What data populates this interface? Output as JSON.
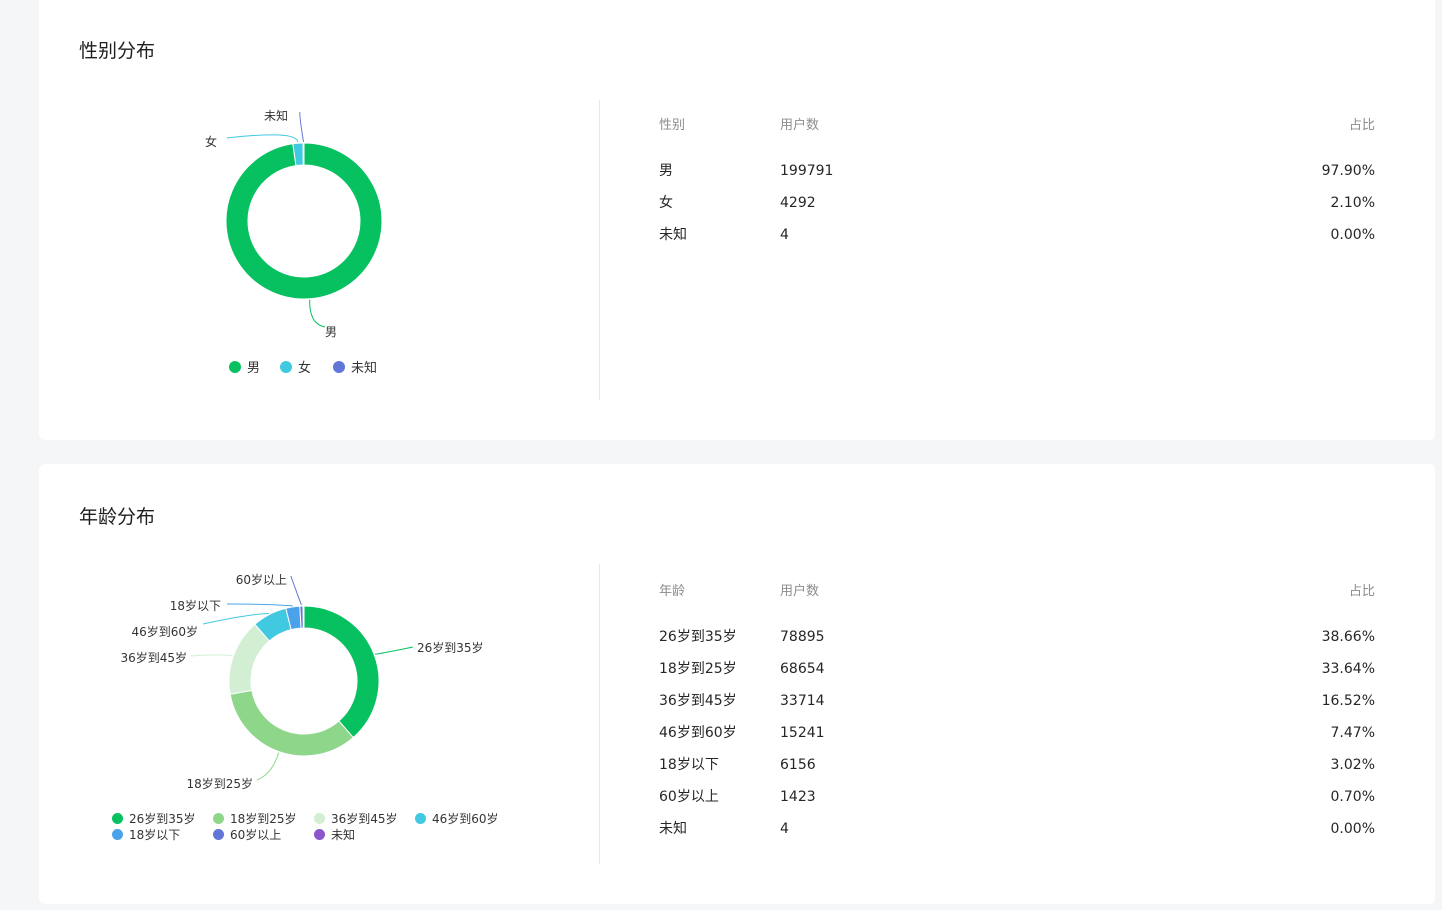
{
  "colors": {
    "male": "#07c160",
    "female": "#40c9e0",
    "unknown": "#6176d6",
    "age": [
      "#07c160",
      "#8ed68a",
      "#d2efd3",
      "#40c9e0",
      "#4aa3ea",
      "#6176d6",
      "#8a57c9"
    ]
  },
  "gender": {
    "title": "性别分布",
    "table": {
      "headers": [
        "性别",
        "用户数",
        "占比"
      ],
      "rows": [
        {
          "label": "男",
          "count": "199791",
          "pct": "97.90%"
        },
        {
          "label": "女",
          "count": "4292",
          "pct": "2.10%"
        },
        {
          "label": "未知",
          "count": "4",
          "pct": "0.00%"
        }
      ]
    }
  },
  "age": {
    "title": "年龄分布",
    "table": {
      "headers": [
        "年龄",
        "用户数",
        "占比"
      ],
      "rows": [
        {
          "label": "26岁到35岁",
          "count": "78895",
          "pct": "38.66%"
        },
        {
          "label": "18岁到25岁",
          "count": "68654",
          "pct": "33.64%"
        },
        {
          "label": "36岁到45岁",
          "count": "33714",
          "pct": "16.52%"
        },
        {
          "label": "46岁到60岁",
          "count": "15241",
          "pct": "7.47%"
        },
        {
          "label": "18岁以下",
          "count": "6156",
          "pct": "3.02%"
        },
        {
          "label": "60岁以上",
          "count": "1423",
          "pct": "0.70%"
        },
        {
          "label": "未知",
          "count": "4",
          "pct": "0.00%"
        }
      ]
    }
  },
  "chart_data": [
    {
      "type": "pie",
      "title": "性别分布",
      "donut": true,
      "categories": [
        "男",
        "女",
        "未知"
      ],
      "values": [
        199791,
        4292,
        4
      ],
      "legend": "bottom"
    },
    {
      "type": "pie",
      "title": "年龄分布",
      "donut": true,
      "categories": [
        "26岁到35岁",
        "18岁到25岁",
        "36岁到45岁",
        "46岁到60岁",
        "18岁以下",
        "60岁以上",
        "未知"
      ],
      "values": [
        78895,
        68654,
        33714,
        15241,
        6156,
        1423,
        4
      ],
      "legend": "bottom"
    }
  ]
}
